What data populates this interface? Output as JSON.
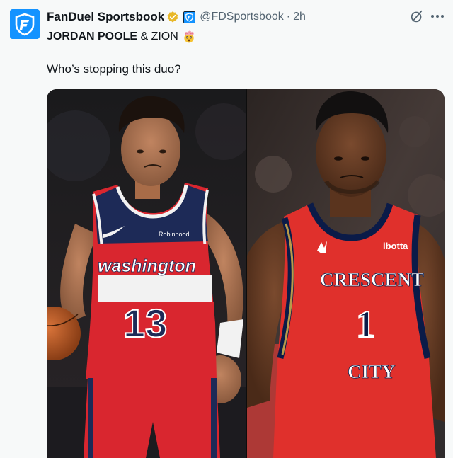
{
  "post": {
    "display_name": "FanDuel Sportsbook",
    "handle": "@FDSportsbook",
    "separator": "·",
    "time": "2h",
    "headline_bold": "JORDAN POOLE",
    "headline_amp": " & ",
    "headline_plain": "ZION",
    "headline_emoji": "exploding-head-emoji",
    "text": "Who’s stopping this duo?"
  },
  "media": {
    "left_player": {
      "team_wordmark": "washington",
      "number": "13",
      "sponsor": "Robinhood",
      "jersey_color": "#d9262f",
      "navy": "#1d2a57"
    },
    "right_player": {
      "team_line1": "CRESCENT",
      "number": "1",
      "team_line2": "CITY",
      "sponsor": "ibotta",
      "jersey_color": "#e0302c",
      "navy": "#0b1b48",
      "gold": "#b89a4b"
    }
  },
  "icons": {
    "avatar": "fanduel-logo-icon",
    "verified": "gold-verified-badge-icon",
    "affiliate": "affiliate-badge-icon",
    "grok": "grok-icon",
    "more": "more-options-icon"
  },
  "colors": {
    "brand": "#1493ff",
    "text": "#0f1419",
    "muted": "#536471",
    "verified_gold": "#e8b829"
  }
}
